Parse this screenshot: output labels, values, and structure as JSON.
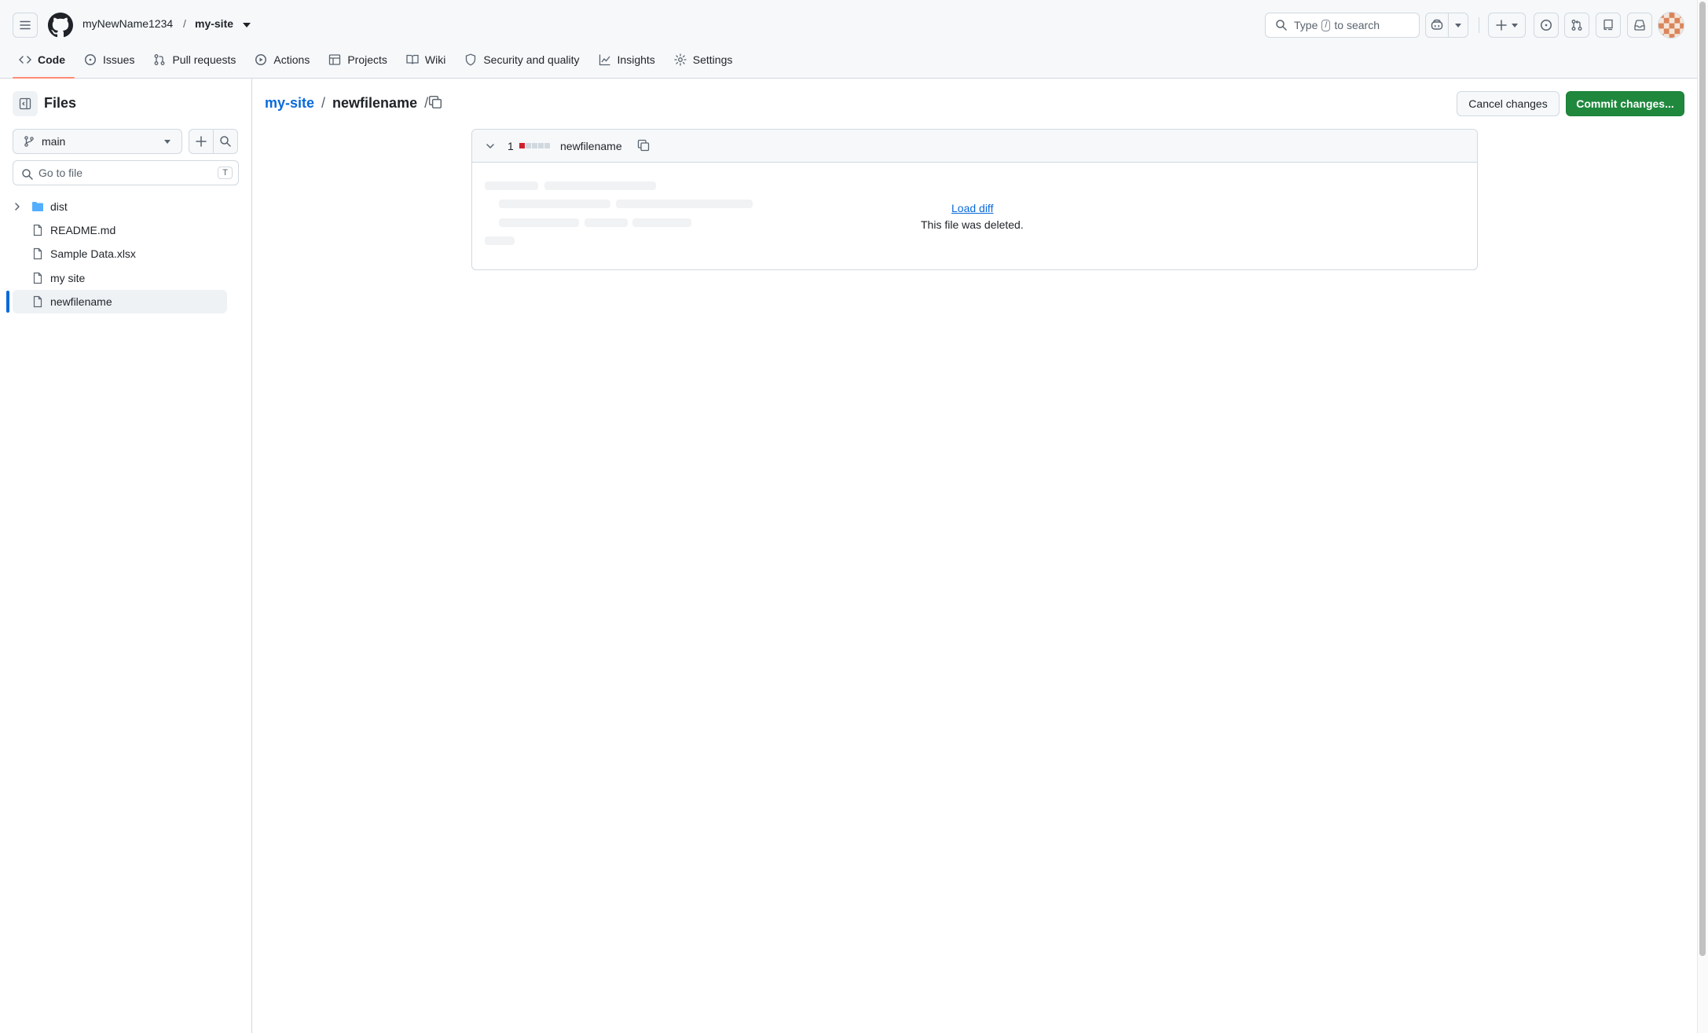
{
  "header": {
    "owner": "myNewName1234",
    "separator": "/",
    "repo": "my-site",
    "search_prefix": "Type",
    "search_key": "/",
    "search_suffix": "to search"
  },
  "tabs": [
    {
      "label": "Code",
      "icon": "code-icon",
      "active": true
    },
    {
      "label": "Issues",
      "icon": "issue-icon"
    },
    {
      "label": "Pull requests",
      "icon": "pull-request-icon"
    },
    {
      "label": "Actions",
      "icon": "play-icon"
    },
    {
      "label": "Projects",
      "icon": "table-icon"
    },
    {
      "label": "Wiki",
      "icon": "book-icon"
    },
    {
      "label": "Security and quality",
      "icon": "shield-icon"
    },
    {
      "label": "Insights",
      "icon": "graph-icon"
    },
    {
      "label": "Settings",
      "icon": "gear-icon"
    }
  ],
  "sidebar": {
    "title": "Files",
    "branch": "main",
    "goto_placeholder": "Go to file",
    "goto_key": "T",
    "tree": [
      {
        "label": "dist",
        "type": "folder"
      },
      {
        "label": "README.md",
        "type": "file"
      },
      {
        "label": "Sample Data.xlsx",
        "type": "file"
      },
      {
        "label": "my site",
        "type": "file"
      },
      {
        "label": "newfilename",
        "type": "file",
        "selected": true
      }
    ]
  },
  "main": {
    "breadcrumb_repo": "my-site",
    "breadcrumb_sep": "/",
    "breadcrumb_file": "newfilename",
    "breadcrumb_trailing_sep": "/",
    "cancel_label": "Cancel changes",
    "commit_label": "Commit changes...",
    "diff": {
      "count": "1",
      "filename": "newfilename",
      "load_label": "Load diff",
      "message": "This file was deleted."
    }
  },
  "colors": {
    "accent": "#0969da",
    "commit_green": "#1f883d",
    "deletion_red": "#cf222e",
    "tab_underline": "#fd8c73"
  }
}
